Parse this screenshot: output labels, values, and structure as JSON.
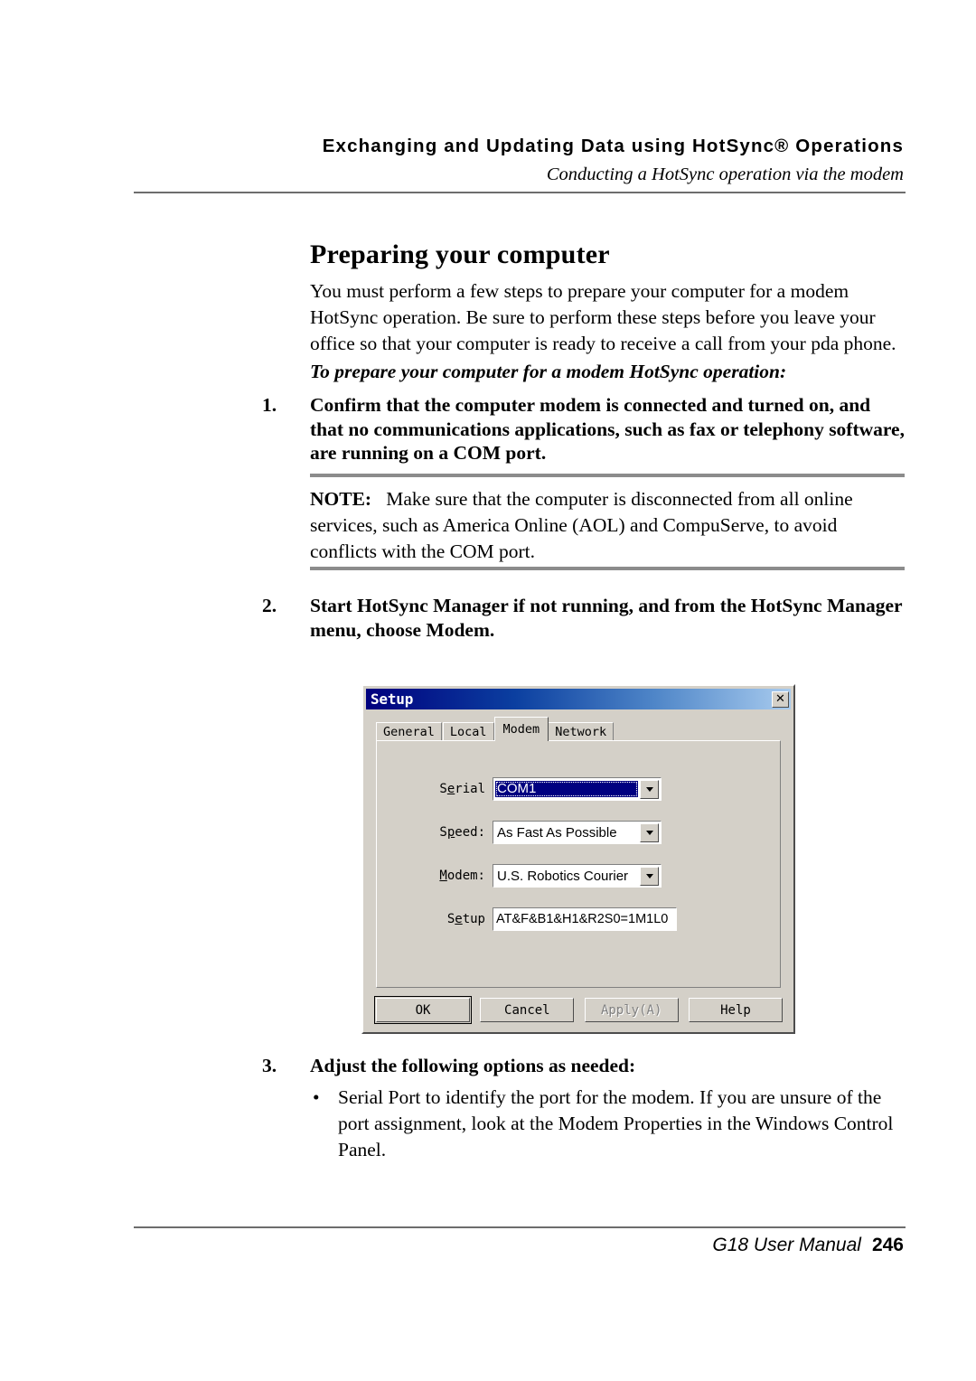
{
  "header": {
    "title": "Exchanging and Updating Data using HotSync® Operations",
    "subtitle": "Conducting a HotSync operation via the modem"
  },
  "main": {
    "heading": "Preparing your computer",
    "intro": "You must perform a few steps to prepare your computer for a modem HotSync operation. Be sure to perform these steps before you leave your office so that your computer is ready to receive a call from your pda phone.",
    "procedure_title": "To prepare your computer for a modem HotSync operation:",
    "steps": [
      {
        "number": "1.",
        "text": "Confirm that the computer modem is connected and turned on, and that no communications applications, such as fax or telephony software, are running on a COM port."
      },
      {
        "number": "2.",
        "text": "Start HotSync Manager if not running, and from the HotSync Manager menu, choose Modem."
      },
      {
        "number": "3.",
        "text": "Adjust the following options as needed:"
      }
    ],
    "note": {
      "label": "NOTE:",
      "text": "Make sure that the computer is disconnected from all online services, such as America Online (AOL) and CompuServe, to avoid conflicts with the COM port."
    },
    "bullet": {
      "marker": "•",
      "text": "Serial Port to identify the port for the modem. If you are unsure of the port assignment, look at the Modem Properties in the Windows Control Panel."
    }
  },
  "dialog": {
    "title": "Setup",
    "close_label": "✕",
    "tabs": [
      {
        "label": "General",
        "active": false
      },
      {
        "label": "Local",
        "active": false
      },
      {
        "label": "Modem",
        "active": true
      },
      {
        "label": "Network",
        "active": false
      }
    ],
    "fields": {
      "serial": {
        "label_pre": "S",
        "label_acc": "e",
        "label_post": "rial",
        "value": "COM1"
      },
      "speed": {
        "label_pre": "S",
        "label_acc": "p",
        "label_post": "eed:",
        "value": "As Fast As Possible"
      },
      "modem": {
        "label_pre": "",
        "label_acc": "M",
        "label_post": "odem:",
        "value": "U.S. Robotics Courier"
      },
      "setup": {
        "label_pre": "S",
        "label_acc": "e",
        "label_post": "tup",
        "value": "AT&F&B1&H1&R2S0=1M1L0"
      }
    },
    "buttons": [
      {
        "label": "OK",
        "state": "default"
      },
      {
        "label": "Cancel",
        "state": "normal"
      },
      {
        "label": "Apply(A)",
        "state": "disabled"
      },
      {
        "label": "Help",
        "state": "normal"
      }
    ],
    "colors": {
      "face": "#d4d0c8",
      "titlebar_start": "#00007e",
      "titlebar_end": "#a8cbee",
      "selection": "#000080"
    }
  },
  "footer": {
    "manual": "G18 User Manual",
    "page": "246"
  }
}
